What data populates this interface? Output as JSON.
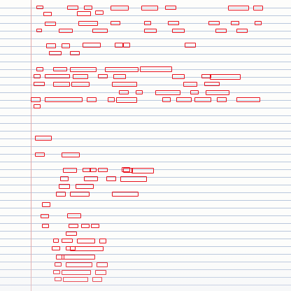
{
  "document": {
    "kind": "handwritten notebook page",
    "highlight_color": "#e8121e",
    "ink_color": "#2a2f6e",
    "rule_color": "#b9c7dc",
    "margin_rule_color": "#e3a9a9",
    "visible_ink": [
      "",
      "",
      "",
      "",
      "",
      "",
      "",
      "",
      "",
      ""
    ],
    "regions": [
      "",
      "",
      "",
      "",
      "",
      "",
      "",
      "",
      "",
      "",
      "",
      "",
      "",
      "",
      "",
      "",
      "",
      "",
      "",
      "",
      "",
      "",
      "",
      "",
      "",
      "",
      "",
      "",
      "",
      "",
      "",
      "",
      "",
      "",
      "",
      "",
      "",
      "",
      "",
      "",
      "",
      "",
      "",
      "",
      "",
      "",
      "",
      "",
      "",
      "",
      "",
      "",
      "",
      "",
      "",
      "",
      "",
      "",
      "",
      "",
      "",
      "",
      "",
      "",
      "",
      "",
      "",
      "",
      "",
      "",
      "",
      "",
      "",
      "",
      "",
      "",
      "",
      "",
      "",
      "",
      "",
      "",
      "",
      "",
      "",
      "",
      "",
      "",
      "",
      "",
      "",
      "",
      "",
      "",
      "",
      "",
      "",
      "",
      "",
      ""
    ]
  }
}
